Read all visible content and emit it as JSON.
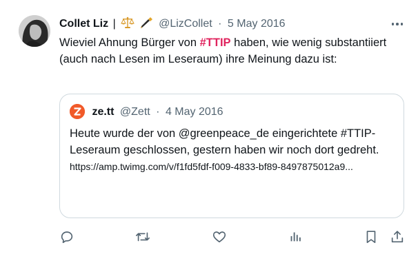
{
  "tweet": {
    "author_name": "Collet Liz",
    "separator": "|",
    "emoji_icons": [
      "scales-icon",
      "fountain-pen-icon"
    ],
    "handle": "@LizCollet",
    "dot": "·",
    "date": "5 May 2016",
    "text_before": "Wieviel Ahnung Bürger von ",
    "hashtag": "#TTIP",
    "text_after": " haben, wie wenig substantiiert (auch nach Lesen im Leseraum) ihre Meinung dazu ist:"
  },
  "quoted": {
    "name": "ze.tt",
    "handle": "@Zett",
    "dot": "·",
    "date": "4 May 2016",
    "text": "Heute wurde der von @greenpeace_de eingerichtete #TTIP-Leseraum geschlossen, gestern haben wir noch dort gedreht.",
    "link": "https://amp.twimg.com/v/f1fd5fdf-f009-4833-bf89-8497875012a9..."
  },
  "actions": [
    "reply-icon",
    "retweet-icon",
    "like-icon",
    "views-icon",
    "bookmark-icon",
    "share-icon"
  ],
  "colors": {
    "text": "#0f1419",
    "secondary": "#536471",
    "hashtag": "#e0245e",
    "border": "#cfd9de",
    "zett_logo": "#f15a29"
  }
}
